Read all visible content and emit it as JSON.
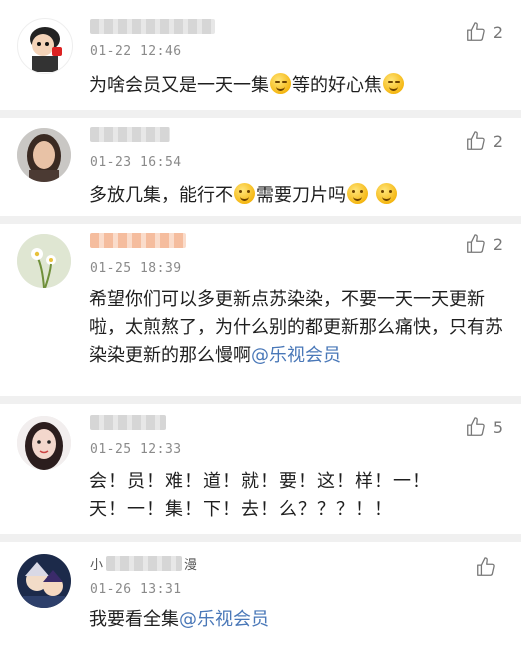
{
  "comments": [
    {
      "time": "01-22 12:46",
      "likes": "2",
      "text_parts": [
        "为啥会员又是一天一集",
        "等的好心焦"
      ],
      "emoji_name": "sly-smile-emoji",
      "avatar": "cartoon-boy-avatar"
    },
    {
      "time": "01-23 16:54",
      "likes": "2",
      "text_parts": [
        "多放几集，能行不",
        "需要刀片吗"
      ],
      "emoji_name": "smile-emoji",
      "avatar": "woman-portrait-avatar"
    },
    {
      "time": "01-25 18:39",
      "likes": "2",
      "text": "希望你们可以多更新点苏染染，不要一天一天更新啦，太煎熬了，为什么别的都更新那么痛快，只有苏染染更新的那么慢啊",
      "mention": "@乐视会员",
      "avatar": "flower-avatar"
    },
    {
      "time": "01-25 12:33",
      "likes": "5",
      "text": "会！员！难！道！就！要！这！样！一！天！一！集！下！去！么？？？！！",
      "avatar": "girl-portrait-avatar"
    },
    {
      "name_prefix": "小",
      "name_suffix": "漫",
      "time": "01-26 13:31",
      "likes": "",
      "text": "我要看全集",
      "mention": "@乐视会员",
      "avatar": "anime-avatar"
    }
  ],
  "colors": {
    "mention": "#4a78b8",
    "time": "#8a8a8a",
    "separator": "#f0f0f0",
    "text": "#1f1f1f"
  },
  "icons": {
    "like": "thumbs-up-icon"
  }
}
